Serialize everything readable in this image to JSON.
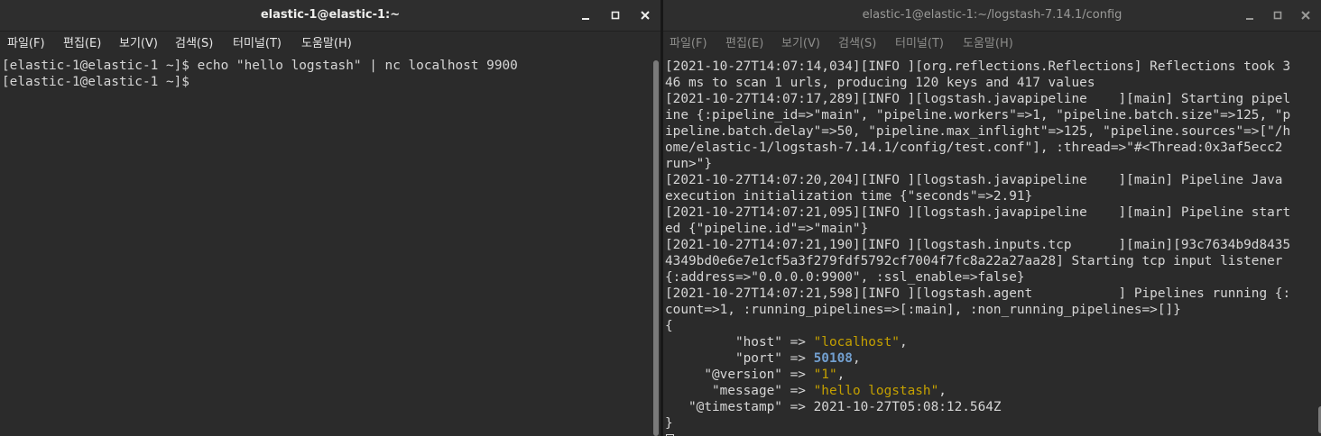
{
  "left_window": {
    "title": "elastic-1@elastic-1:~",
    "menu": [
      "파일(F)",
      "편집(E)",
      "보기(V)",
      "검색(S)",
      "터미널(T)",
      "도움말(H)"
    ],
    "lines": [
      "[elastic-1@elastic-1 ~]$ echo \"hello logstash\" | nc localhost 9900",
      "[elastic-1@elastic-1 ~]$ "
    ]
  },
  "right_window": {
    "title": "elastic-1@elastic-1:~/logstash-7.14.1/config",
    "menu": [
      "파일(F)",
      "편집(E)",
      "보기(V)",
      "검색(S)",
      "터미널(T)",
      "도움말(H)"
    ],
    "log_lines": [
      "[2021-10-27T14:07:14,034][INFO ][org.reflections.Reflections] Reflections took 3",
      "46 ms to scan 1 urls, producing 120 keys and 417 values",
      "[2021-10-27T14:07:17,289][INFO ][logstash.javapipeline    ][main] Starting pipel",
      "ine {:pipeline_id=>\"main\", \"pipeline.workers\"=>1, \"pipeline.batch.size\"=>125, \"p",
      "ipeline.batch.delay\"=>50, \"pipeline.max_inflight\"=>125, \"pipeline.sources\"=>[\"/h",
      "ome/elastic-1/logstash-7.14.1/config/test.conf\"], :thread=>\"#<Thread:0x3af5ecc2",
      "run>\"}",
      "[2021-10-27T14:07:20,204][INFO ][logstash.javapipeline    ][main] Pipeline Java",
      "execution initialization time {\"seconds\"=>2.91}",
      "[2021-10-27T14:07:21,095][INFO ][logstash.javapipeline    ][main] Pipeline start",
      "ed {\"pipeline.id\"=>\"main\"}",
      "[2021-10-27T14:07:21,190][INFO ][logstash.inputs.tcp      ][main][93c7634b9d8435",
      "4349bd0e6e7e1cf5a3f279fdf5792cf7004f7fc8a22a27aa28] Starting tcp input listener",
      "{:address=>\"0.0.0.0:9900\", :ssl_enable=>false}",
      "[2021-10-27T14:07:21,598][INFO ][logstash.agent           ] Pipelines running {:",
      "count=>1, :running_pipelines=>[:main], :non_running_pipelines=>[]}",
      "{"
    ],
    "event": [
      {
        "key": "\"host\"",
        "value": "\"localhost\"",
        "suffix": ",",
        "color": "#c4a000"
      },
      {
        "key": "\"port\"",
        "value": "50108",
        "suffix": ",",
        "color": "#729fcf"
      },
      {
        "key": "\"@version\"",
        "value": "\"1\"",
        "suffix": ",",
        "color": "#c4a000"
      },
      {
        "key": "\"message\"",
        "value": "\"hello logstash\"",
        "suffix": ",",
        "color": "#c4a000"
      },
      {
        "key": "\"@timestamp\"",
        "value": "2021-10-27T05:08:12.564Z",
        "suffix": "",
        "color": "#d6d6d6"
      }
    ],
    "closing_line": "}"
  },
  "colors": {
    "terminal_bg": "#2b2b2b",
    "terminal_fg": "#d6d6d6",
    "string_yellow": "#c4a000",
    "number_blue": "#729fcf"
  }
}
